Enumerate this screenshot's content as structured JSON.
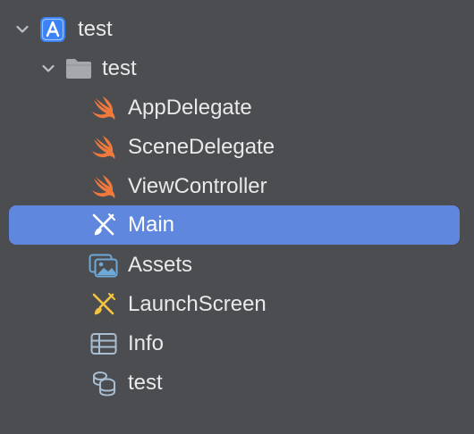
{
  "colors": {
    "background": "#4b4d51",
    "selection": "#5f87dd",
    "text": "#e9e9eb",
    "swift_orange": "#f2793c",
    "project_blue": "#3b82f6",
    "folder_gray": "#a6a8ad",
    "storyboard_yellow": "#f5c542",
    "assets_blue": "#6fa8d6"
  },
  "tree": {
    "project": {
      "label": "test",
      "icon": "xcode-project-icon",
      "expanded": true
    },
    "group": {
      "label": "test",
      "icon": "folder-icon",
      "expanded": true
    },
    "files": [
      {
        "label": "AppDelegate",
        "icon": "swift-file-icon",
        "selected": false
      },
      {
        "label": "SceneDelegate",
        "icon": "swift-file-icon",
        "selected": false
      },
      {
        "label": "ViewController",
        "icon": "swift-file-icon",
        "selected": false
      },
      {
        "label": "Main",
        "icon": "storyboard-icon",
        "selected": true
      },
      {
        "label": "Assets",
        "icon": "asset-catalog-icon",
        "selected": false
      },
      {
        "label": "LaunchScreen",
        "icon": "storyboard-icon",
        "selected": false
      },
      {
        "label": "Info",
        "icon": "plist-icon",
        "selected": false
      },
      {
        "label": "test",
        "icon": "data-model-icon",
        "selected": false
      }
    ]
  }
}
